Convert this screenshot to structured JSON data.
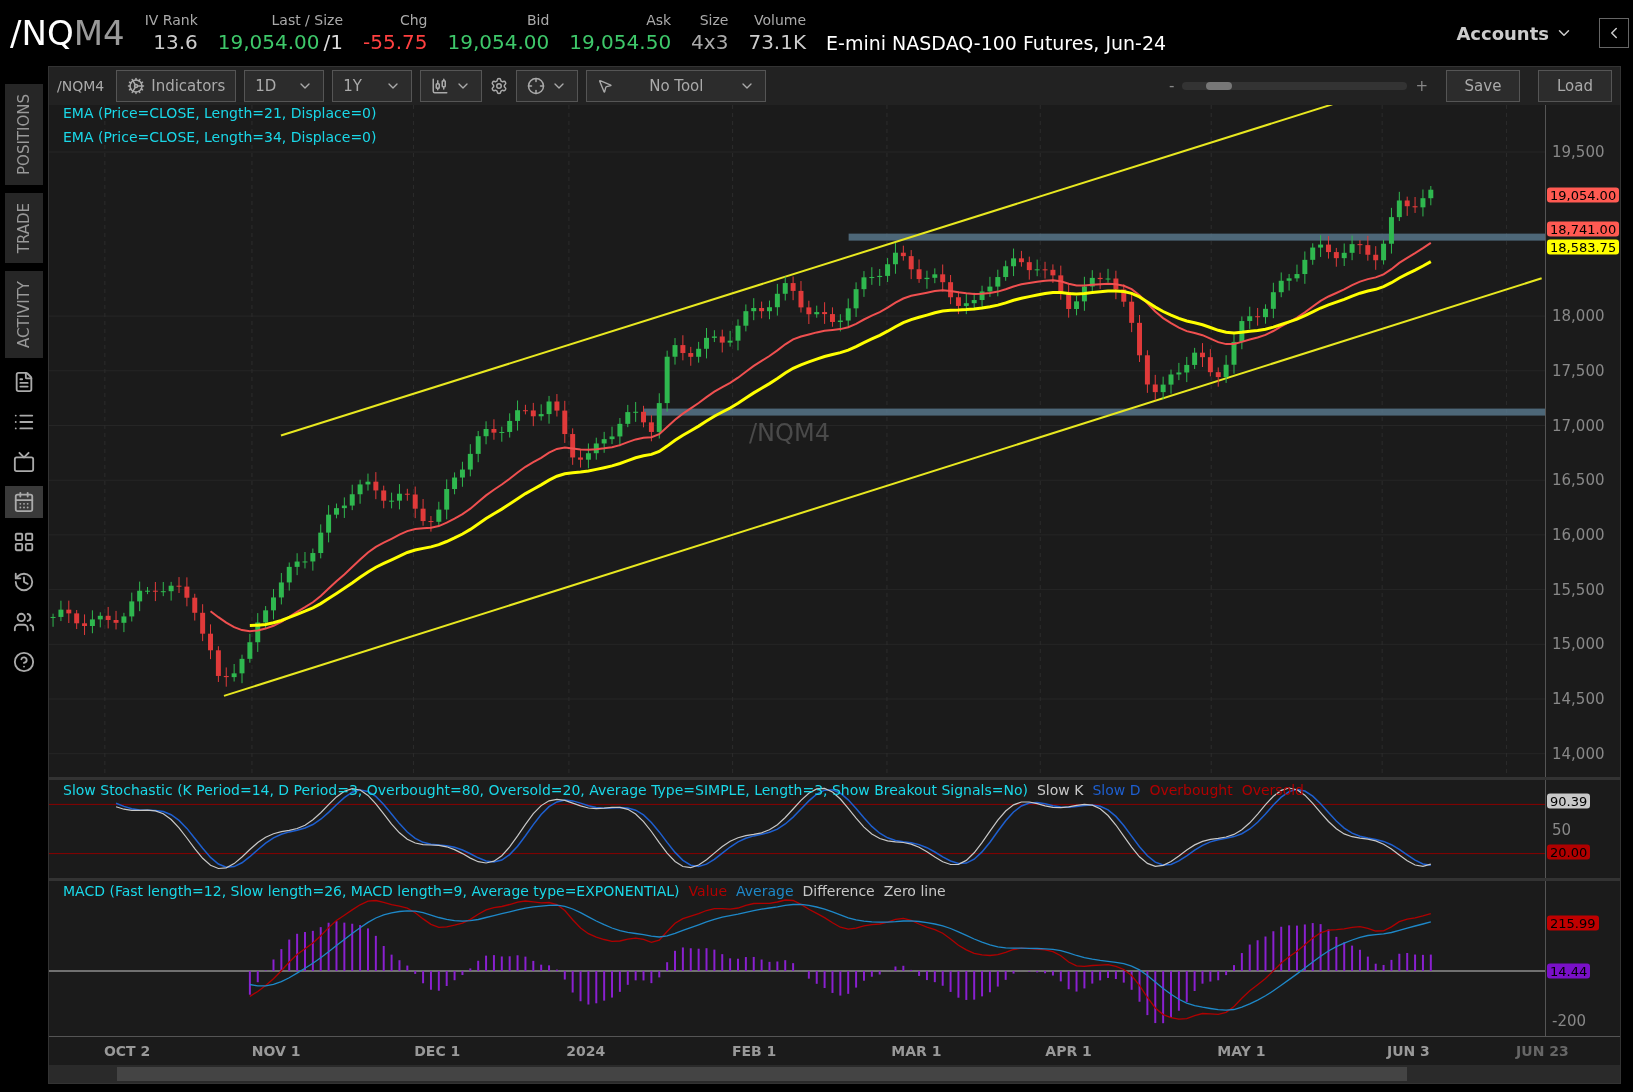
{
  "header": {
    "symbol_root": "/NQ",
    "symbol_suffix": "M4",
    "quotes": [
      {
        "label": "IV Rank",
        "value": "13.6",
        "color": "#cccccc"
      },
      {
        "label": "Last / Size",
        "value": "19,054.00",
        "extra": "/1",
        "color": "#3ec86a"
      },
      {
        "label": "Chg",
        "value": "-55.75",
        "color": "#ff4040"
      },
      {
        "label": "Bid",
        "value": "19,054.00",
        "color": "#3ec86a"
      },
      {
        "label": "Ask",
        "value": "19,054.50",
        "color": "#3ec86a"
      },
      {
        "label": "Size",
        "value": "4x3",
        "color": "#aaaaaa"
      },
      {
        "label": "Volume",
        "value": "73.1K",
        "color": "#cccccc"
      }
    ],
    "description": "E-mini NASDAQ-100 Futures, Jun-24",
    "accounts": "Accounts"
  },
  "sidebar": {
    "tabs": [
      "POSITIONS",
      "TRADE",
      "ACTIVITY"
    ],
    "icons": [
      {
        "selected": false
      },
      {
        "selected": false
      },
      {
        "selected": false
      },
      {
        "selected": true
      },
      {
        "selected": false
      },
      {
        "selected": false
      },
      {
        "selected": false
      },
      {
        "selected": false
      }
    ]
  },
  "toolbar": {
    "symbol": "/NQM4",
    "indicators": "Indicators",
    "aggregation": "1D",
    "range": "1Y",
    "tool": "No Tool",
    "zoom_out": "-",
    "zoom_in": "+",
    "zoom_slider": {
      "level": 0.12
    },
    "buttons": [
      "Save",
      "Load"
    ]
  },
  "price_panel": {
    "studies": [
      "EMA (Price=CLOSE, Length=21, Displace=0)",
      "EMA (Price=CLOSE, Length=34, Displace=0)"
    ],
    "watermark": "/NQM4",
    "axis": [
      "19,500",
      "18,000",
      "17,500",
      "17,000",
      "16,500",
      "16,000",
      "15,500",
      "15,000",
      "14,500",
      "14,000"
    ],
    "tags": [
      {
        "text": "19,054.00",
        "color": "#ff5a52"
      },
      {
        "text": "18,741.00",
        "color": "#ff5a52"
      },
      {
        "text": "18,583.75",
        "color": "#ffff00"
      }
    ]
  },
  "stochastic": {
    "title": "Slow Stochastic (K Period=14, D Period=3, Overbought=80, Oversold=20, Average Type=SIMPLE, Length=3, Show Breakout Signals=No)",
    "legend": [
      {
        "text": "Slow K",
        "color": "#c8c8c8"
      },
      {
        "text": "Slow D",
        "color": "#1e5fd0"
      },
      {
        "text": "Overbought",
        "color": "#b00000"
      },
      {
        "text": "Oversold",
        "color": "#b00000"
      }
    ],
    "axis": [
      "50"
    ],
    "tags": [
      {
        "text": "90.39",
        "color": "#c8c8c8"
      },
      {
        "text": "20.00",
        "color": "#b00000"
      }
    ]
  },
  "macd": {
    "title": "MACD (Fast length=12, Slow length=26, MACD length=9, Average type=EXPONENTIAL)",
    "legend": [
      {
        "text": "Value",
        "color": "#b00000"
      },
      {
        "text": "Average",
        "color": "#1e88c8"
      },
      {
        "text": "Difference",
        "color": "#c8c8c8"
      },
      {
        "text": "Zero line",
        "color": "#c8c8c8"
      }
    ],
    "axis": [
      "-200"
    ],
    "tags": [
      {
        "text": "215.99",
        "color": "#c00000"
      },
      {
        "text": "14.44",
        "color": "#7a10c8"
      }
    ]
  },
  "time_axis": [
    "OCT 2",
    "NOV 1",
    "DEC 1",
    "2024",
    "FEB 1",
    "MAR 1",
    "APR 1",
    "MAY 1",
    "JUN 3",
    "JUN 23"
  ]
}
